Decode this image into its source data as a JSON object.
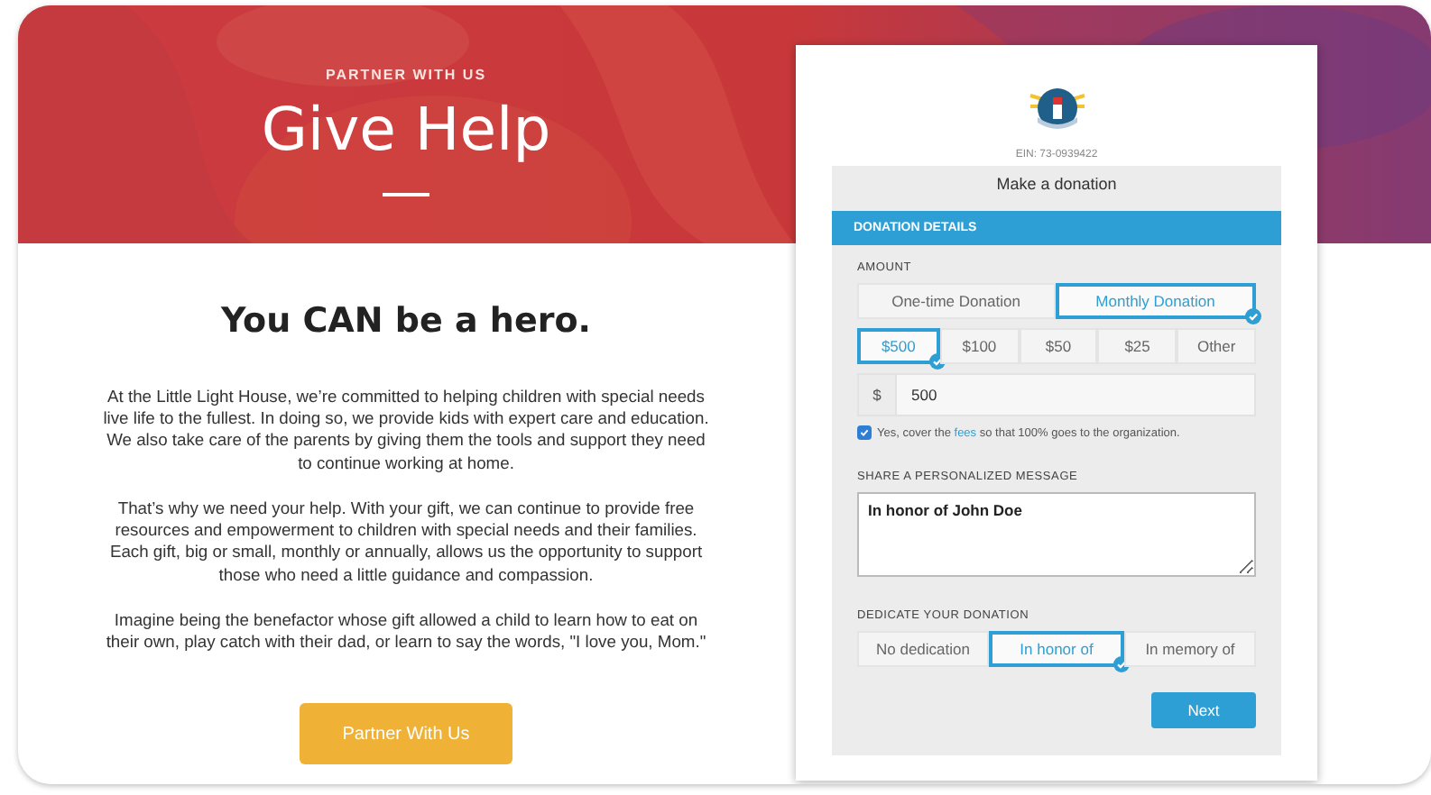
{
  "hero": {
    "kind": "picture",
    "eyebrow": "PARTNER WITH US",
    "title": "Give Help"
  },
  "heading": "You CAN be a hero.",
  "paragraphs": [
    "At the Little Light House, we’re committed to helping children with special needs live life to the fullest. In doing so, we provide kids with expert care and education. We also take care of the parents by giving them the tools and support they need to continue working at home.",
    "That’s why we need your help. With your gift, we can continue to provide free resources and empowerment to children with special needs and their families. Each gift, big or small, monthly or annually, allows us the opportunity to support those who need a little guidance and compassion.",
    "Imagine being the benefactor whose gift allowed a child to learn how to eat on their own, play catch with their dad, or learn to say the words, \"I love you, Mom.\""
  ],
  "cta_button": "Partner With Us",
  "donation_form": {
    "ein": "EIN: 73-0939422",
    "title": "Make a donation",
    "section_header": "DONATION DETAILS",
    "amount_label": "AMOUNT",
    "frequency_options": [
      {
        "label": "One-time Donation",
        "selected": false
      },
      {
        "label": "Monthly Donation",
        "selected": true
      }
    ],
    "amount_options": [
      {
        "label": "$500",
        "selected": true
      },
      {
        "label": "$100",
        "selected": false
      },
      {
        "label": "$50",
        "selected": false
      },
      {
        "label": "$25",
        "selected": false
      },
      {
        "label": "Other",
        "selected": false
      }
    ],
    "currency_symbol": "$",
    "amount_value": "500",
    "cover_fees": {
      "checked": true,
      "text_before": "Yes, cover the",
      "link": "fees",
      "text_after": "so that 100% goes to the organization."
    },
    "message_label": "SHARE A PERSONALIZED MESSAGE",
    "message_value": "In honor of John Doe",
    "dedicate_label": "DEDICATE YOUR DONATION",
    "dedication_options": [
      {
        "label": "No dedication",
        "selected": false
      },
      {
        "label": "In honor of",
        "selected": true
      },
      {
        "label": "In memory of",
        "selected": false
      }
    ],
    "next_button": "Next"
  }
}
